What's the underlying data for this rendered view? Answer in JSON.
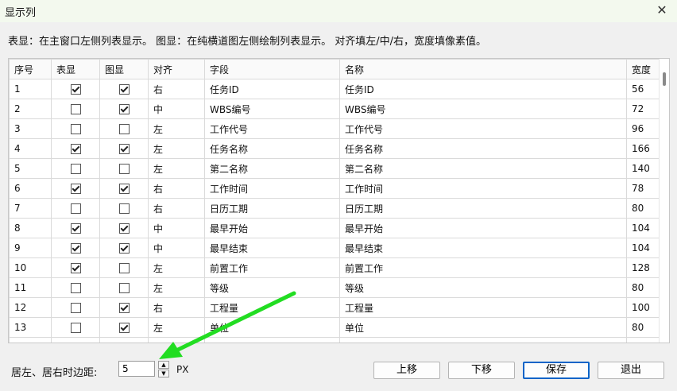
{
  "window": {
    "title": "显示列"
  },
  "description": "表显：在主窗口左侧列表显示。 图显：在纯横道图左侧绘制列表显示。 对齐填左/中/右，宽度填像素值。",
  "table": {
    "headers": [
      "序号",
      "表显",
      "图显",
      "对齐",
      "字段",
      "名称",
      "宽度"
    ],
    "rows": [
      {
        "no": "1",
        "table_show": true,
        "chart_show": true,
        "align": "右",
        "field": "任务ID",
        "name": "任务ID",
        "width": "56"
      },
      {
        "no": "2",
        "table_show": false,
        "chart_show": true,
        "align": "中",
        "field": "WBS编号",
        "name": "WBS编号",
        "width": "72"
      },
      {
        "no": "3",
        "table_show": false,
        "chart_show": false,
        "align": "左",
        "field": "工作代号",
        "name": "工作代号",
        "width": "96"
      },
      {
        "no": "4",
        "table_show": true,
        "chart_show": true,
        "align": "左",
        "field": "任务名称",
        "name": "任务名称",
        "width": "166"
      },
      {
        "no": "5",
        "table_show": false,
        "chart_show": false,
        "align": "左",
        "field": "第二名称",
        "name": "第二名称",
        "width": "140"
      },
      {
        "no": "6",
        "table_show": true,
        "chart_show": true,
        "align": "右",
        "field": "工作时间",
        "name": "工作时间",
        "width": "78"
      },
      {
        "no": "7",
        "table_show": false,
        "chart_show": false,
        "align": "右",
        "field": "日历工期",
        "name": "日历工期",
        "width": "80"
      },
      {
        "no": "8",
        "table_show": true,
        "chart_show": true,
        "align": "中",
        "field": "最早开始",
        "name": "最早开始",
        "width": "104"
      },
      {
        "no": "9",
        "table_show": true,
        "chart_show": true,
        "align": "中",
        "field": "最早结束",
        "name": "最早结束",
        "width": "104"
      },
      {
        "no": "10",
        "table_show": true,
        "chart_show": false,
        "align": "左",
        "field": "前置工作",
        "name": "前置工作",
        "width": "128"
      },
      {
        "no": "11",
        "table_show": false,
        "chart_show": false,
        "align": "左",
        "field": "等级",
        "name": "等级",
        "width": "80"
      },
      {
        "no": "12",
        "table_show": false,
        "chart_show": true,
        "align": "右",
        "field": "工程量",
        "name": "工程量",
        "width": "100"
      },
      {
        "no": "13",
        "table_show": false,
        "chart_show": true,
        "align": "左",
        "field": "单位",
        "name": "单位",
        "width": "80"
      },
      {
        "no": "",
        "table_show": false,
        "chart_show": false,
        "align": "",
        "field": "",
        "name": "",
        "width": ""
      }
    ]
  },
  "margin": {
    "label": "居左、居右时边距:",
    "value": "5",
    "unit": "PX"
  },
  "buttons": {
    "up": "上移",
    "down": "下移",
    "save": "保存",
    "exit": "退出"
  },
  "colors": {
    "annotation_arrow": "#22dd22",
    "primary_border": "#0a64c8"
  }
}
